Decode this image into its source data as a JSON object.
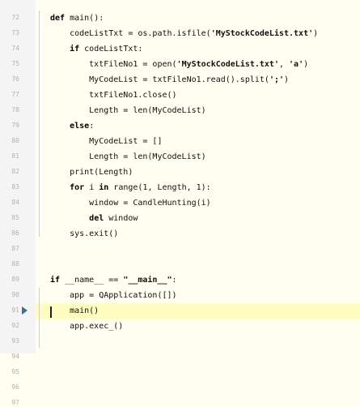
{
  "editor": {
    "line_numbers": [
      "72",
      "73",
      "74",
      "75",
      "76",
      "77",
      "78",
      "79",
      "80",
      "81",
      "82",
      "83",
      "84",
      "85",
      "86",
      "87",
      "88",
      "89",
      "90",
      "91",
      "92",
      "93",
      "94",
      "95",
      "96",
      "97"
    ],
    "lines": [
      {
        "parts": [
          {
            "t": "def ",
            "c": "kw"
          },
          {
            "t": "main():",
            "c": ""
          }
        ]
      },
      {
        "parts": [
          {
            "t": "    codeListTxt = os.path.isfile(",
            "c": ""
          },
          {
            "t": "'MyStockCodeList.txt'",
            "c": "str"
          },
          {
            "t": ")",
            "c": ""
          }
        ]
      },
      {
        "parts": [
          {
            "t": "    ",
            "c": ""
          },
          {
            "t": "if ",
            "c": "kw"
          },
          {
            "t": "codeListTxt:",
            "c": ""
          }
        ]
      },
      {
        "parts": [
          {
            "t": "        txtFileNo1 = open(",
            "c": ""
          },
          {
            "t": "'MyStockCodeList.txt'",
            "c": "str"
          },
          {
            "t": ", ",
            "c": ""
          },
          {
            "t": "'a'",
            "c": "str"
          },
          {
            "t": ")",
            "c": ""
          }
        ]
      },
      {
        "parts": [
          {
            "t": "        MyCodeList = txtFileNo1.read().split(",
            "c": ""
          },
          {
            "t": "';'",
            "c": "str"
          },
          {
            "t": ")",
            "c": ""
          }
        ]
      },
      {
        "parts": [
          {
            "t": "        txtFileNo1.close()",
            "c": ""
          }
        ]
      },
      {
        "parts": [
          {
            "t": "        Length = len(MyCodeList)",
            "c": ""
          }
        ]
      },
      {
        "parts": [
          {
            "t": "    ",
            "c": ""
          },
          {
            "t": "else",
            "c": "kw"
          },
          {
            "t": ":",
            "c": ""
          }
        ]
      },
      {
        "parts": [
          {
            "t": "        MyCodeList = []",
            "c": ""
          }
        ]
      },
      {
        "parts": [
          {
            "t": "        Length = len(MyCodeList)",
            "c": ""
          }
        ]
      },
      {
        "parts": [
          {
            "t": "    print(Length)",
            "c": ""
          }
        ]
      },
      {
        "parts": [
          {
            "t": "    ",
            "c": ""
          },
          {
            "t": "for ",
            "c": "kw"
          },
          {
            "t": "i ",
            "c": ""
          },
          {
            "t": "in ",
            "c": "kw"
          },
          {
            "t": "range(1, Length, 1):",
            "c": ""
          }
        ]
      },
      {
        "parts": [
          {
            "t": "        window = CandleHunting(i)",
            "c": ""
          }
        ]
      },
      {
        "parts": [
          {
            "t": "        ",
            "c": ""
          },
          {
            "t": "del ",
            "c": "kw"
          },
          {
            "t": "window",
            "c": ""
          }
        ]
      },
      {
        "parts": [
          {
            "t": "    sys.exit()",
            "c": ""
          }
        ]
      },
      {
        "parts": []
      },
      {
        "parts": []
      },
      {
        "parts": [
          {
            "t": "if ",
            "c": "kw"
          },
          {
            "t": "__name__ == ",
            "c": ""
          },
          {
            "t": "\"__main__\"",
            "c": "str"
          },
          {
            "t": ":",
            "c": ""
          }
        ]
      },
      {
        "parts": [
          {
            "t": "    app = QApplication([])",
            "c": ""
          }
        ]
      },
      {
        "parts": [
          {
            "t": "    main()",
            "c": ""
          }
        ]
      },
      {
        "parts": [
          {
            "t": "    app.exec_()",
            "c": ""
          }
        ]
      }
    ],
    "line_numbers_for_lines": [
      "",
      "",
      "",
      "",
      "",
      "",
      "",
      "",
      "",
      "",
      "",
      "",
      "",
      "",
      "",
      "",
      "",
      "",
      "",
      "",
      ""
    ]
  }
}
